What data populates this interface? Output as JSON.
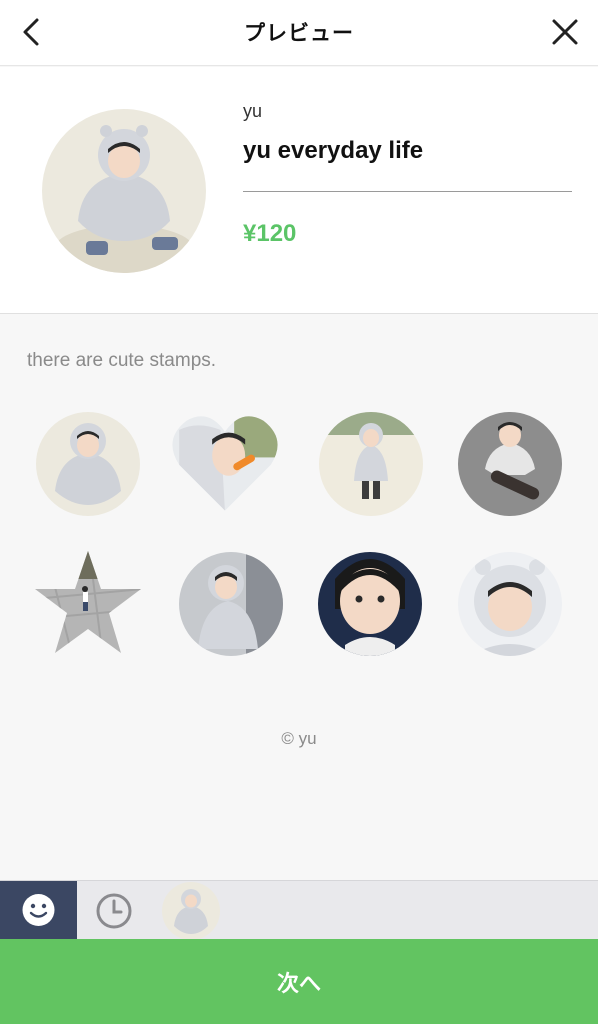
{
  "header": {
    "title": "プレビュー"
  },
  "product": {
    "author": "yu",
    "title": "yu everyday life",
    "price": "¥120"
  },
  "description": "there are cute stamps.",
  "copyright": "© yu",
  "stamps": [
    {
      "shape": "circle"
    },
    {
      "shape": "heart"
    },
    {
      "shape": "circle"
    },
    {
      "shape": "circle"
    },
    {
      "shape": "star"
    },
    {
      "shape": "circle"
    },
    {
      "shape": "circle"
    },
    {
      "shape": "circle"
    }
  ],
  "tabs": [
    {
      "icon": "smiley-icon"
    },
    {
      "icon": "clock-icon"
    },
    {
      "icon": "sticker-pack-thumbnail"
    }
  ],
  "next_button": "次へ",
  "colors": {
    "price": "#5bc467",
    "next_button": "#62c461",
    "emoji_tab": "#3b4763"
  }
}
